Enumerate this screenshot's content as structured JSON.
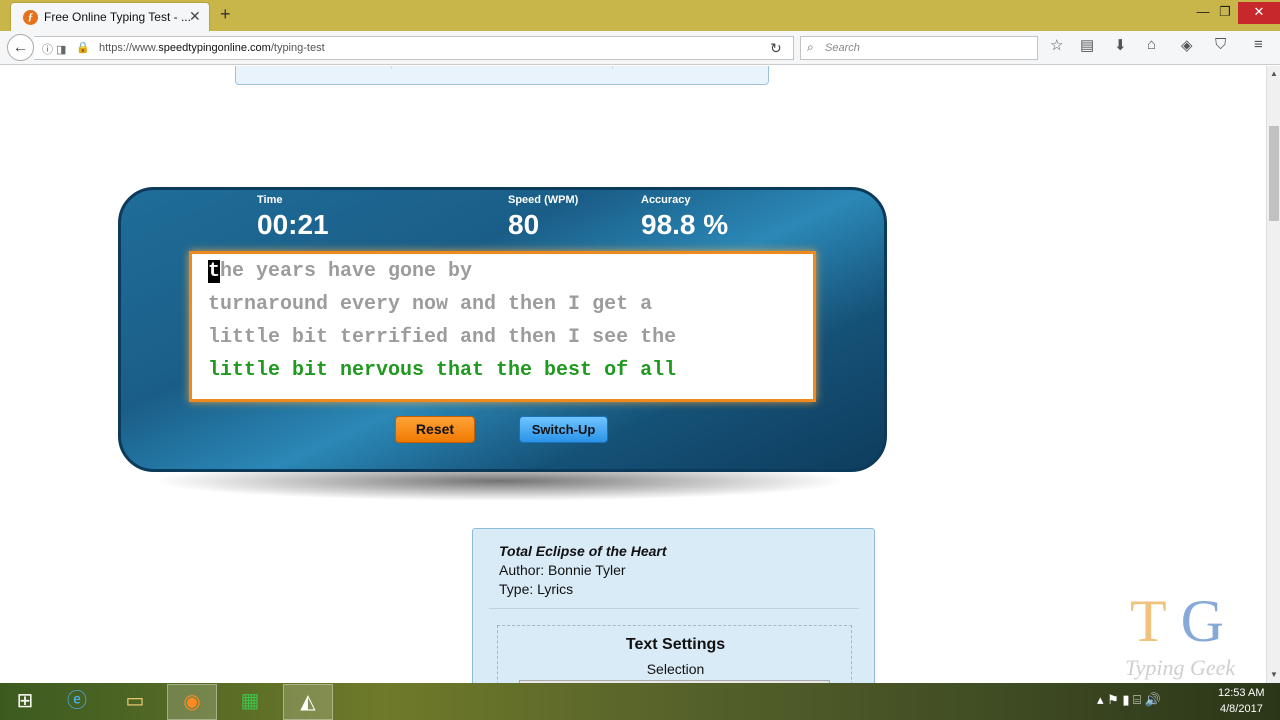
{
  "browser": {
    "tab_title": "Free Online Typing Test - ...",
    "tab_favicon": "typing-favicon",
    "url_prefix": "https://www.",
    "url_host": "speedtypingonline.com",
    "url_path": "/typing-test",
    "search_placeholder": "Search"
  },
  "stats": {
    "time_label": "Time",
    "time_value": "00:21",
    "speed_label": "Speed (WPM)",
    "speed_value": "80",
    "accuracy_label": "Accuracy",
    "accuracy_value": "98.8 %"
  },
  "typing": {
    "cursor_char": "t",
    "line1_rest": "he years have gone by",
    "line2": "turnaround every now and then I get a",
    "line3": "little bit terrified and then I see the",
    "line4": "little bit nervous that the best of all"
  },
  "buttons": {
    "reset": "Reset",
    "switch_up": "Switch-Up"
  },
  "info": {
    "title": "Total Eclipse of the Heart",
    "author": "Author: Bonnie Tyler",
    "type": "Type: Lyrics",
    "settings_title": "Text Settings",
    "selection_label": "Selection"
  },
  "watermark": {
    "letter_t": "T",
    "letter_g": "G",
    "subtitle": "Typing Geek"
  },
  "taskbar": {
    "time": "12:53 AM",
    "date": "4/8/2017"
  },
  "colors": {
    "title_bar": "#c9b64a",
    "text_border": "#ee8a1d",
    "typed_text": "#1f9a1f",
    "pending_text": "#9c9c9c",
    "reset_button": "#f07a00",
    "switch_button": "#2a93e8"
  }
}
